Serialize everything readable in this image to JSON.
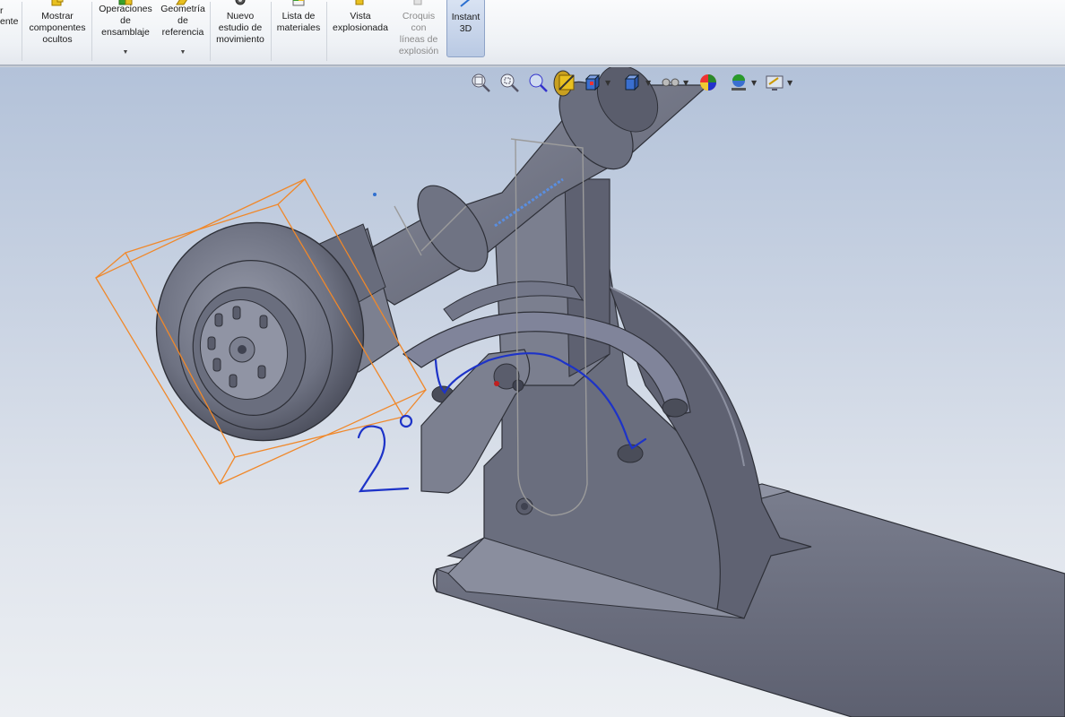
{
  "ribbon": {
    "items": [
      {
        "id": "partial",
        "label": "ente",
        "arrow": false
      },
      {
        "id": "show-hidden",
        "label": "Mostrar\ncomponentes\nocultos",
        "arrow": false
      },
      {
        "id": "assembly-ops",
        "label": "Operaciones\nde\nensamblaje",
        "arrow": true
      },
      {
        "id": "ref-geometry",
        "label": "Geometría\nde\nreferencia",
        "arrow": true
      },
      {
        "id": "motion-study",
        "label": "Nuevo\nestudio de\nmovimiento",
        "arrow": false
      },
      {
        "id": "bom",
        "label": "Lista de\nmateriales",
        "arrow": false
      },
      {
        "id": "exploded-view",
        "label": "Vista\nexplosionada",
        "arrow": false
      },
      {
        "id": "explode-sketch",
        "label": "Croquis\ncon\nlíneas de\nexplosión",
        "arrow": false,
        "disabled": true
      },
      {
        "id": "instant3d",
        "label": "Instant\n3D",
        "arrow": false,
        "active": true
      }
    ],
    "partial_prefix": "r"
  },
  "viewbar": {
    "icons": [
      "zoom-to-fit-icon",
      "zoom-to-area-icon",
      "previous-view-icon",
      "section-view-icon",
      "view-orientation-icon",
      "display-style-icon",
      "hide-show-items-icon",
      "edit-appearance-icon",
      "apply-scene-icon",
      "view-settings-icon"
    ]
  },
  "annotation": {
    "text": "2°",
    "color": "#1d33c8"
  },
  "colors": {
    "model": "#6b6f80",
    "model_light": "#8c90a0",
    "model_dark": "#50535f",
    "bbox": "#f0882a",
    "sketch_line": "#2b45d8"
  }
}
